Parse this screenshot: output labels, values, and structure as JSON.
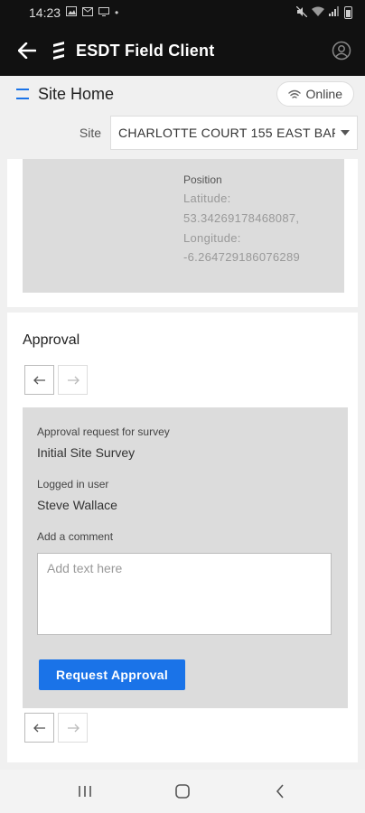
{
  "status_bar": {
    "time": "14:23",
    "dot": "•"
  },
  "app_bar": {
    "title": "ESDT Field Client"
  },
  "page": {
    "title": "Site Home",
    "online_label": "Online"
  },
  "site": {
    "label": "Site",
    "value": "CHARLOTTE COURT 155 EAST BAR..."
  },
  "position": {
    "heading": "Position",
    "lines": [
      "Latitude:",
      "53.34269178468087,",
      "Longitude:",
      "-6.264729186076289"
    ]
  },
  "approval": {
    "title": "Approval",
    "request_label": "Approval request for survey",
    "request_value": "Initial Site Survey",
    "user_label": "Logged in user",
    "user_value": "Steve Wallace",
    "comment_label": "Add a comment",
    "comment_placeholder": "Add text here",
    "button_label": "Request Approval"
  }
}
